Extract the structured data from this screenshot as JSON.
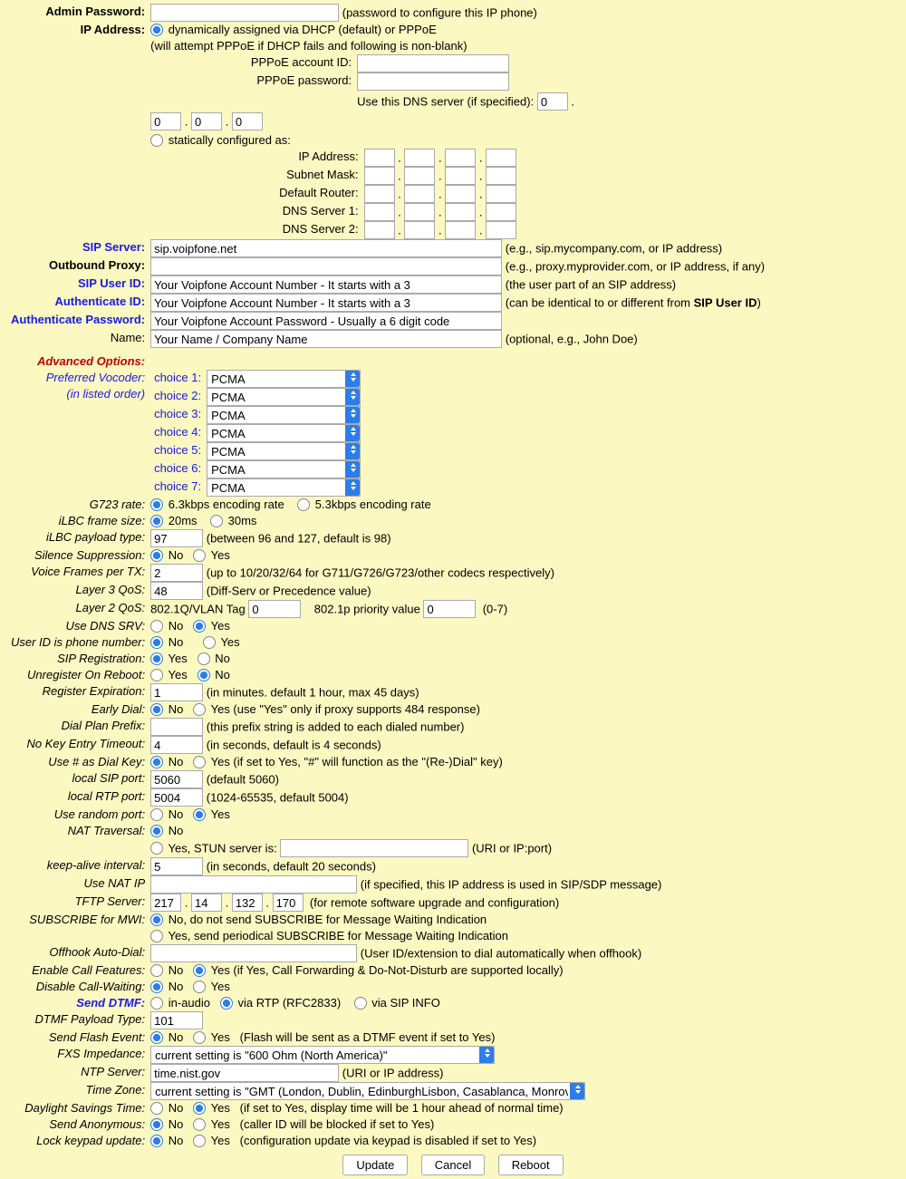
{
  "labels": {
    "admin_password": "Admin Password:",
    "admin_password_hint": "(password to configure this IP phone)",
    "ip_address": "IP Address:",
    "dhcp_opt": "dynamically assigned via DHCP (default) or PPPoE",
    "pppoe_note": "(will attempt PPPoE if DHCP fails and following is non-blank)",
    "pppoe_id": "PPPoE account ID:",
    "pppoe_pw": "PPPoE password:",
    "use_dns": "Use this DNS server (if specified):",
    "static_opt": "statically configured as:",
    "ip_addr": "IP Address:",
    "subnet": "Subnet Mask:",
    "router": "Default Router:",
    "dns1": "DNS Server 1:",
    "dns2": "DNS Server 2:",
    "sip_server": "SIP Server:",
    "sip_server_hint": "(e.g., sip.mycompany.com, or IP address)",
    "outbound": "Outbound Proxy:",
    "outbound_hint": "(e.g., proxy.myprovider.com, or IP address, if any)",
    "sip_user": "SIP User ID:",
    "sip_user_hint": "(the user part of an SIP address)",
    "auth_id": "Authenticate ID:",
    "auth_id_hint_a": "(can be identical to or different from ",
    "auth_id_hint_b": "SIP User ID",
    "auth_id_hint_c": ")",
    "auth_pw": "Authenticate Password:",
    "name": "Name:",
    "name_hint": "(optional, e.g., John Doe)",
    "adv": "Advanced Options:",
    "pref_vocoder": "Preferred Vocoder:",
    "in_order": "(in listed order)",
    "choice": "choice ",
    "g723": "G723 rate:",
    "g723_a": "6.3kbps encoding rate",
    "g723_b": "5.3kbps encoding rate",
    "ilbc_fs": "iLBC frame size:",
    "ilbc_20": "20ms",
    "ilbc_30": "30ms",
    "ilbc_pt": "iLBC payload type:",
    "ilbc_pt_hint": "(between 96 and 127, default is 98)",
    "silence": "Silence Suppression:",
    "vftx": "Voice Frames per TX:",
    "vftx_hint": "(up to 10/20/32/64 for G711/G726/G723/other codecs respectively)",
    "l3qos": "Layer 3 QoS:",
    "l3qos_hint": "(Diff-Serv or Precedence value)",
    "l2qos": "Layer 2 QoS:",
    "l2qos_a": "802.1Q/VLAN Tag",
    "l2qos_b": "802.1p priority value",
    "l2qos_c": "(0-7)",
    "dnssrv": "Use DNS SRV:",
    "uid_phone": "User ID is phone number:",
    "sip_reg": "SIP Registration:",
    "unreg": "Unregister On Reboot:",
    "reg_exp": "Register Expiration:",
    "reg_exp_hint": "(in minutes. default 1 hour, max 45 days)",
    "early": "Early Dial:",
    "early_hint": "Yes (use \"Yes\" only if proxy supports 484 response)",
    "dial_prefix": "Dial Plan Prefix:",
    "dial_prefix_hint": "(this prefix string is added to each dialed number)",
    "no_key": "No Key Entry Timeout:",
    "no_key_hint": "(in seconds, default is 4 seconds)",
    "hash_dial": "Use # as Dial Key:",
    "hash_dial_hint": "Yes (if set to Yes, \"#\" will function as the \"(Re-)Dial\" key)",
    "lsip": "local SIP port:",
    "lsip_hint": "(default 5060)",
    "lrtp": "local RTP port:",
    "lrtp_hint": "(1024-65535, default 5004)",
    "rand_port": "Use random port:",
    "nat": "NAT Traversal:",
    "nat_stun": "Yes, STUN server is:",
    "nat_stun_hint": "(URI or IP:port)",
    "keepalive": "keep-alive interval:",
    "keepalive_hint": "(in seconds, default 20 seconds)",
    "use_nat_ip": "Use NAT IP",
    "use_nat_ip_hint": "(if specified, this IP address is used in SIP/SDP message)",
    "tftp": "TFTP Server:",
    "tftp_hint": "(for remote software upgrade and configuration)",
    "mwi": "SUBSCRIBE for MWI:",
    "mwi_a": "No, do not send SUBSCRIBE for Message Waiting Indication",
    "mwi_b": "Yes, send periodical SUBSCRIBE for Message Waiting Indication",
    "offhook": "Offhook Auto-Dial:",
    "offhook_hint": "(User ID/extension to dial automatically when offhook)",
    "callfeat": "Enable Call Features:",
    "callfeat_hint": "Yes (if Yes, Call Forwarding & Do-Not-Disturb are supported locally)",
    "disable_cw": "Disable Call-Waiting:",
    "send_dtmf": "Send DTMF:",
    "dtmf_a": "in-audio",
    "dtmf_b": "via RTP (RFC2833)",
    "dtmf_c": "via SIP INFO",
    "dtmf_pt": "DTMF Payload Type:",
    "flash": "Send Flash Event:",
    "flash_hint": "(Flash will be sent as a DTMF event if set to Yes)",
    "fxs": "FXS Impedance:",
    "ntp": "NTP Server:",
    "ntp_hint": "(URI or IP address)",
    "tz": "Time Zone:",
    "dst": "Daylight Savings Time:",
    "dst_hint": "(if set to Yes, display time will be 1 hour ahead of normal time)",
    "anon": "Send Anonymous:",
    "anon_hint": "(caller ID will be blocked if set to Yes)",
    "lock": "Lock keypad update:",
    "lock_hint": "(configuration update via keypad is disabled if set to Yes)",
    "no": "No",
    "yes": "Yes"
  },
  "values": {
    "dns_octet": "0",
    "sip_server": "sip.voipfone.net",
    "sip_user": "Your Voipfone Account Number - It starts with a 3",
    "auth_id": "Your Voipfone Account Number - It starts with a 3",
    "auth_pw": "Your Voipfone Account Password - Usually a 6 digit code",
    "name": "Your Name / Company Name",
    "vocoder": "PCMA",
    "ilbc_pt": "97",
    "vftx": "2",
    "l3qos": "48",
    "vlan": "0",
    "priority": "0",
    "reg_exp": "1",
    "no_key": "4",
    "lsip": "5060",
    "lrtp": "5004",
    "keepalive": "5",
    "tftp": [
      "217",
      "14",
      "132",
      "170"
    ],
    "dtmf_pt": "101",
    "fxs": "current setting is \"600 Ohm (North America)\"",
    "ntp": "time.nist.gov",
    "tz": "current setting is \"GMT (London, Dublin, EdinburghLisbon, Casablanca, Monrovia)\""
  },
  "buttons": {
    "update": "Update",
    "cancel": "Cancel",
    "reboot": "Reboot"
  }
}
